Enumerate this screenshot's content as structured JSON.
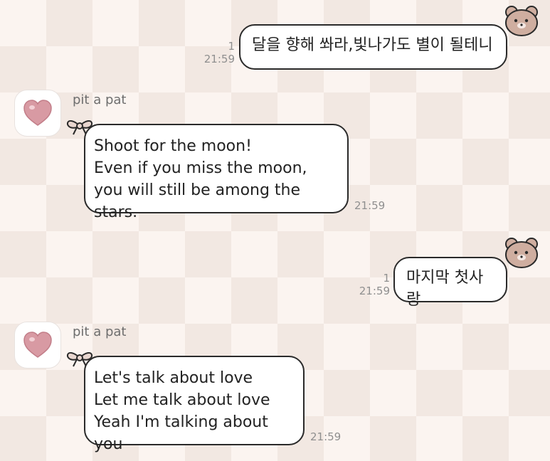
{
  "messages": [
    {
      "direction": "sent",
      "text": "달을 향해 쏴라,빛나가도 별이 될테니",
      "unread": "1",
      "time": "21:59"
    },
    {
      "direction": "received",
      "sender": "pit a pat",
      "text": "Shoot for the moon!\nEven if you miss the moon,\nyou will still be among the stars.",
      "time": "21:59"
    },
    {
      "direction": "sent",
      "text": "마지막 첫사랑",
      "unread": "1",
      "time": "21:59"
    },
    {
      "direction": "received",
      "sender": "pit a pat",
      "text": "Let's talk about love\nLet me talk about love\nYeah I'm talking about you",
      "time": "21:59"
    }
  ],
  "icons": {
    "avatar": "heart-icon",
    "sent_sticker": "bear-icon",
    "recv_decoration": "bow-icon"
  },
  "colors": {
    "background_light": "#fbf4f0",
    "background_dark": "#f2e8e2",
    "bubble": "#ffffff",
    "border": "#2a2a2a",
    "heart": "#d89aa3",
    "bear": "#cfaea0",
    "bow": "#e8d6cf"
  }
}
